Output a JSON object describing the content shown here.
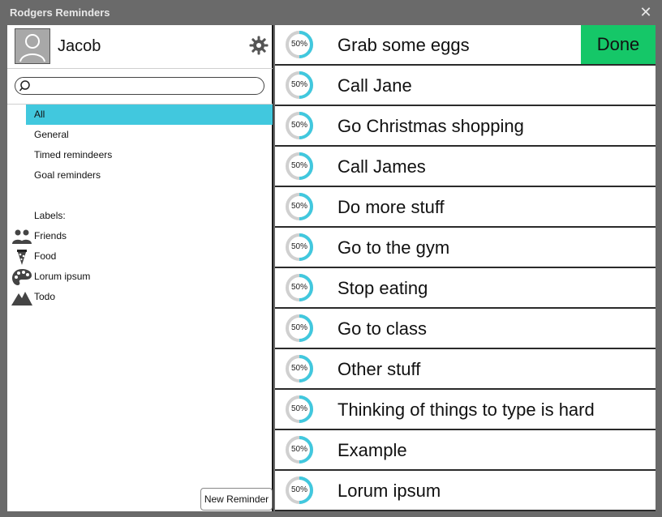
{
  "window": {
    "title": "Rodgers Reminders"
  },
  "user": {
    "name": "Jacob"
  },
  "search": {
    "placeholder": ""
  },
  "nav": {
    "items": [
      "All",
      "General",
      "Timed remindeers",
      "Goal reminders"
    ]
  },
  "labels": {
    "heading": "Labels:",
    "items": [
      {
        "text": "Friends",
        "icon": "people-icon"
      },
      {
        "text": "Food",
        "icon": "pizza-icon"
      },
      {
        "text": "Lorum ipsum",
        "icon": "palette-icon"
      },
      {
        "text": "Todo",
        "icon": "mountain-icon"
      }
    ]
  },
  "buttons": {
    "new_reminder": "New Reminder",
    "done": "Done"
  },
  "reminders": [
    {
      "text": "Grab some eggs",
      "progress": "50%"
    },
    {
      "text": "Call Jane",
      "progress": "50%"
    },
    {
      "text": "Go Christmas shopping",
      "progress": "50%"
    },
    {
      "text": "Call James",
      "progress": "50%"
    },
    {
      "text": "Do more stuff",
      "progress": "50%"
    },
    {
      "text": "Go to the gym",
      "progress": "50%"
    },
    {
      "text": "Stop eating",
      "progress": "50%"
    },
    {
      "text": "Go to class",
      "progress": "50%"
    },
    {
      "text": "Other stuff",
      "progress": "50%"
    },
    {
      "text": "Thinking of things to type is hard",
      "progress": "50%"
    },
    {
      "text": "Example",
      "progress": "50%"
    },
    {
      "text": "Lorum ipsum",
      "progress": "50%"
    }
  ],
  "colors": {
    "accent": "#41c8de",
    "done": "#15c768",
    "progress": "#41c8de",
    "track": "#d0d0d0"
  }
}
